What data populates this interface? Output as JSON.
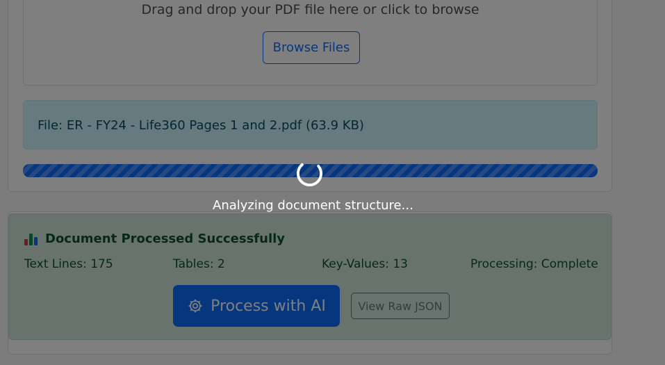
{
  "upload": {
    "drop_text": "Drag and drop your PDF file here or click to browse",
    "browse_label": "Browse Files",
    "file_info": "File: ER - FY24 - Life360 Pages 1 and 2.pdf (63.9 KB)",
    "progress_percent": 100
  },
  "result": {
    "title": "Document Processed Successfully",
    "stats": {
      "text_lines": "Text Lines: 175",
      "tables": "Tables: 2",
      "key_values": "Key-Values: 13",
      "processing": "Processing: Complete"
    },
    "process_ai_label": "Process with AI",
    "view_json_label": "View Raw JSON"
  },
  "overlay": {
    "loading_text": "Analyzing document structure..."
  },
  "colors": {
    "primary": "#0d6efd",
    "success_bg": "#d1e7dd",
    "info_bg": "#cff4fc"
  },
  "icons": {
    "result_title": "bar-chart-icon",
    "process_ai": "gear-icon",
    "loading": "spinner-icon"
  }
}
